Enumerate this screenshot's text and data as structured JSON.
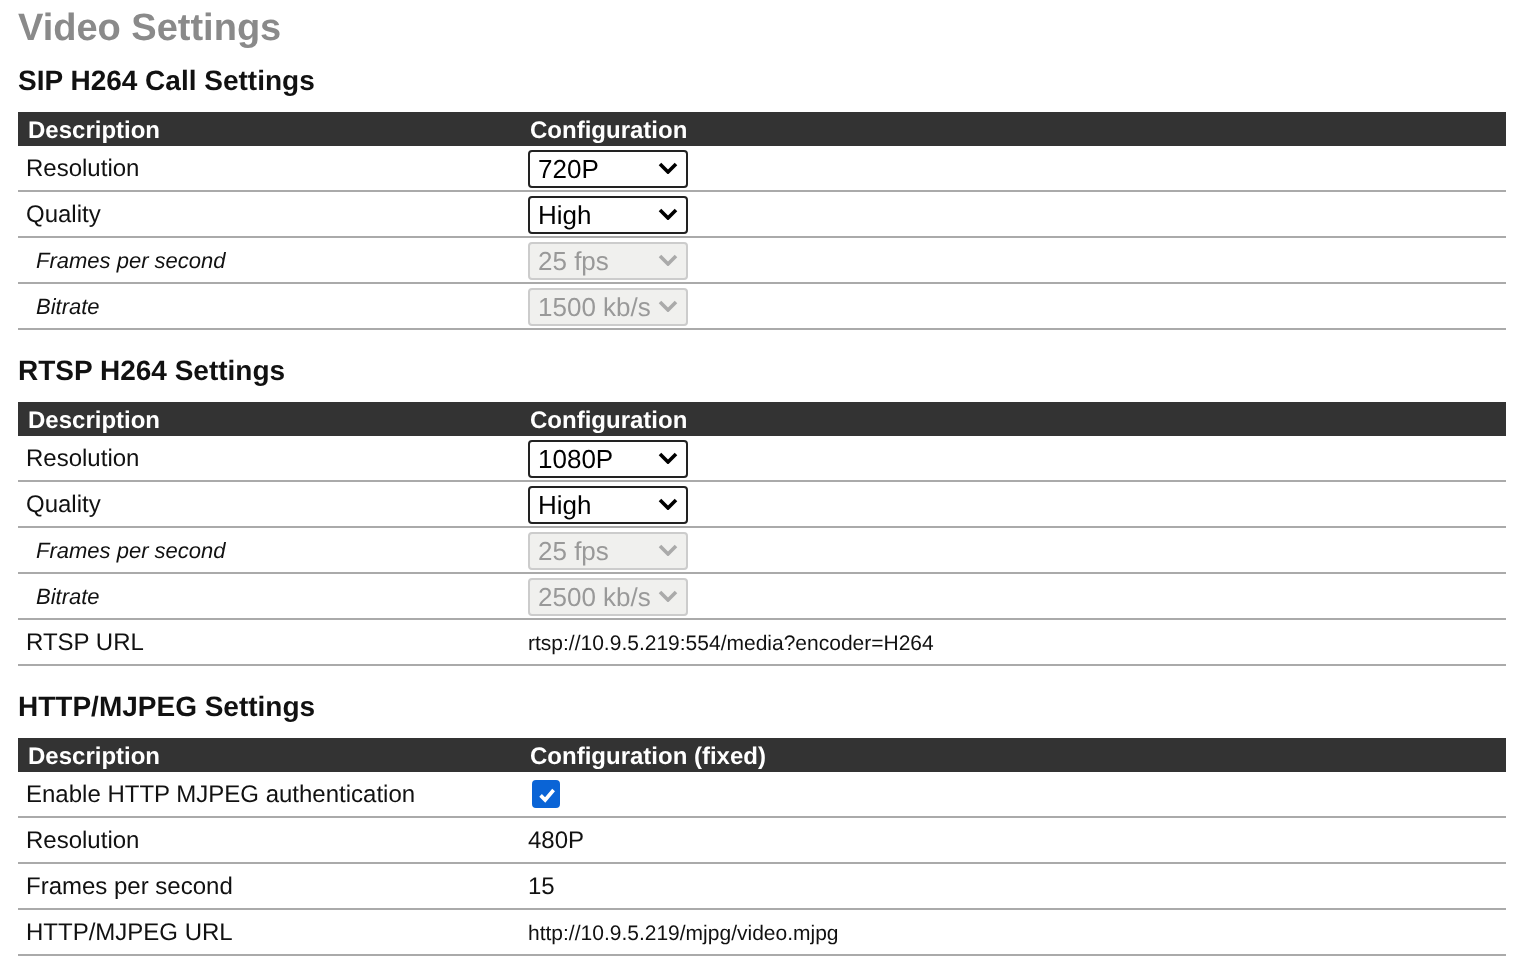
{
  "title": "Video Settings",
  "sections": [
    {
      "heading": "SIP H264 Call Settings",
      "columns": [
        "Description",
        "Configuration"
      ],
      "rows": [
        {
          "label": "Resolution",
          "kind": "select",
          "value": "720P",
          "disabled": false,
          "sub": false
        },
        {
          "label": "Quality",
          "kind": "select",
          "value": "High",
          "disabled": false,
          "sub": false
        },
        {
          "label": "Frames per second",
          "kind": "select",
          "value": "25 fps",
          "disabled": true,
          "sub": true
        },
        {
          "label": "Bitrate",
          "kind": "select",
          "value": "1500 kb/s",
          "disabled": true,
          "sub": true
        }
      ]
    },
    {
      "heading": "RTSP H264 Settings",
      "columns": [
        "Description",
        "Configuration"
      ],
      "rows": [
        {
          "label": "Resolution",
          "kind": "select",
          "value": "1080P",
          "disabled": false,
          "sub": false
        },
        {
          "label": "Quality",
          "kind": "select",
          "value": "High",
          "disabled": false,
          "sub": false
        },
        {
          "label": "Frames per second",
          "kind": "select",
          "value": "25 fps",
          "disabled": true,
          "sub": true
        },
        {
          "label": "Bitrate",
          "kind": "select",
          "value": "2500 kb/s",
          "disabled": true,
          "sub": true
        },
        {
          "label": "RTSP URL",
          "kind": "url",
          "value": "rtsp://10.9.5.219:554/media?encoder=H264",
          "sub": false
        }
      ]
    },
    {
      "heading": "HTTP/MJPEG Settings",
      "columns": [
        "Description",
        "Configuration (fixed)"
      ],
      "rows": [
        {
          "label": "Enable HTTP MJPEG authentication",
          "kind": "checkbox",
          "checked": true,
          "sub": false
        },
        {
          "label": "Resolution",
          "kind": "text",
          "value": "480P",
          "sub": false
        },
        {
          "label": "Frames per second",
          "kind": "text",
          "value": "15",
          "sub": false
        },
        {
          "label": "HTTP/MJPEG URL",
          "kind": "url",
          "value": "http://10.9.5.219/mjpg/video.mjpg",
          "sub": false
        }
      ]
    }
  ]
}
